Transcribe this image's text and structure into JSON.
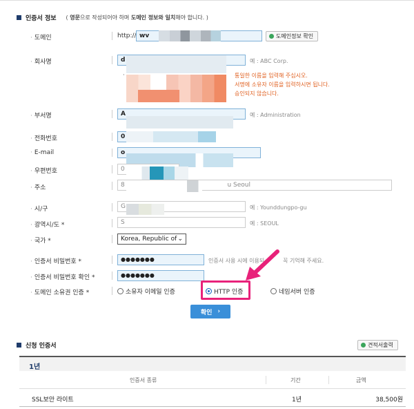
{
  "section1": {
    "title": "인증서 정보",
    "note_prefix": "( ",
    "note_en": "영문",
    "note_mid": "으로 작성되어야 하며 ",
    "note_bold": "도메인 정보와 일치",
    "note_suffix": "해야 합니다. )"
  },
  "fields": {
    "domain": {
      "label": "도메인",
      "value": "http://",
      "value2": "wv",
      "button": "도메인정보 확인"
    },
    "company": {
      "label": "회사명",
      "value": "d",
      "hint": "예 : ABC Corp.",
      "warn1": "통일한 이름을 입력해 주십시오.",
      "warn2": "서명에 소유자 이름을 입력하시면 됩니다.",
      "warn3": "승인되지 않습니다."
    },
    "department": {
      "label": "부서명",
      "value": "A",
      "hint": "예 : Administration"
    },
    "phone": {
      "label": "전화번호",
      "value": "0"
    },
    "email": {
      "label": "E-mail",
      "value": "o"
    },
    "zipcode": {
      "label": "우편번호",
      "value": "0"
    },
    "address": {
      "label": "주소",
      "value": "8",
      "value_tail": "u Seoul"
    },
    "city": {
      "label": "시/구",
      "value": "G",
      "hint": "예 : Younddungpo-gu"
    },
    "province": {
      "label": "광역시/도 *",
      "value": "S",
      "hint": "예 : SEOUL"
    },
    "country": {
      "label": "국가 *",
      "value": "Korea, Republic of"
    },
    "cert_password": {
      "label": "인증서 비밀번호 *",
      "value": "●●●●●●●",
      "hint": "인증서 사용 시에 이용되",
      "hint_tail": "꼭 기억해 주세요."
    },
    "cert_password_confirm": {
      "label": "인증서 비밀번호 확인 *",
      "value": "●●●●●●●"
    },
    "domain_auth": {
      "label": "도메인 소유권 인증 *",
      "options": [
        "소유자 이메일 인증",
        "HTTP 인증",
        "네임서버 인증"
      ],
      "selected": "HTTP 인증"
    }
  },
  "confirm_button": "확인",
  "section2": {
    "title": "신청 인증서",
    "estimate_button": "견적서출력",
    "group_label": "1년",
    "columns": [
      "인증서 종류",
      "기간",
      "금액"
    ],
    "rows": [
      {
        "name": "SSL보안 라이트",
        "period": "1년",
        "price": "38,500원"
      }
    ]
  },
  "colors": {
    "accent": "#3a8fd9",
    "highlight": "#e8227a",
    "warn": "#e06020",
    "input_bg": "#eaf4fb"
  }
}
